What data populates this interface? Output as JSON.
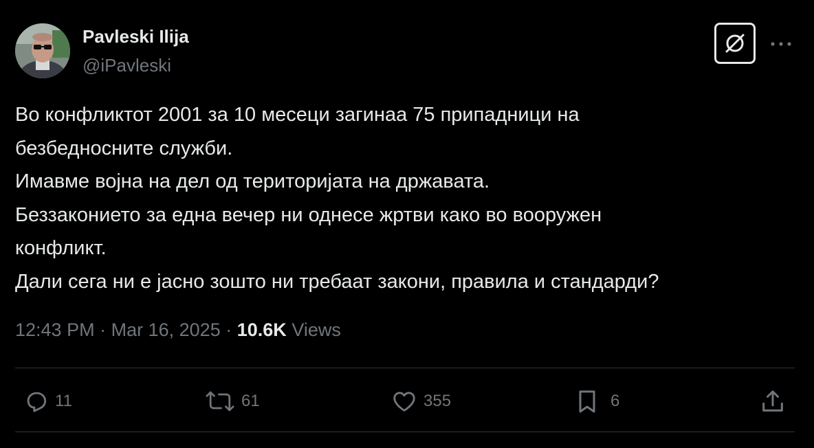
{
  "author": {
    "display_name": "Pavleski Ilija",
    "handle": "@iPavleski",
    "avatar_icon": "profile-photo"
  },
  "header": {
    "grok_icon": "grok-icon",
    "more_icon": "more-icon"
  },
  "tweet": {
    "lines": [
      "Во конфликтот 2001 за 10 месеци загинаа 75 припадници на",
      "безбедносните служби.",
      "Имавме војна на дел од територијата на државата.",
      "Беззаконието за една вечер ни однесе жртви како во вооружен",
      "конфликт.",
      "Дали сега ни е јасно зошто ни требаат закони, правила и стандарди?"
    ]
  },
  "meta": {
    "time": "12:43 PM",
    "separator": "·",
    "date": "Mar 16, 2025",
    "views_count": "10.6K",
    "views_label": "Views"
  },
  "actions": {
    "replies": "11",
    "reposts": "61",
    "likes": "355",
    "bookmarks": "6"
  },
  "colors": {
    "background": "#000000",
    "text": "#e7e9ea",
    "secondary": "#71767b",
    "divider": "#2f3336"
  }
}
